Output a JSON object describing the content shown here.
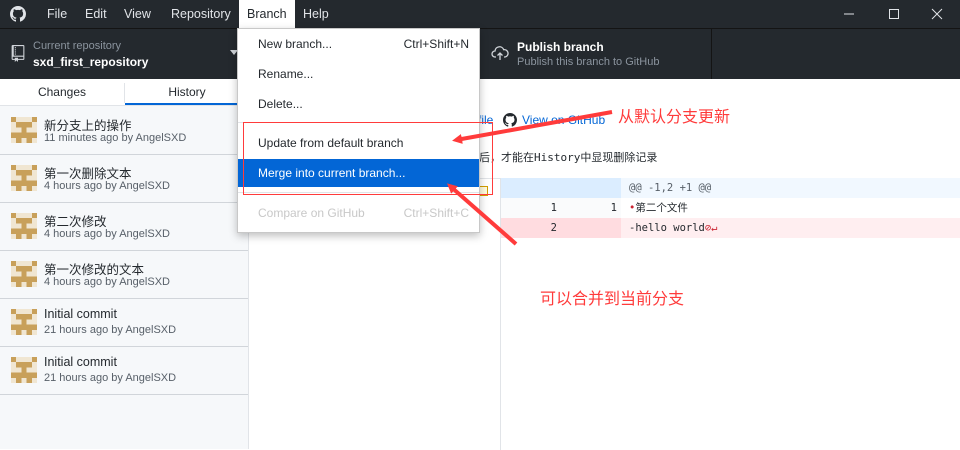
{
  "titlebar": {
    "menus": [
      "File",
      "Edit",
      "View",
      "Repository",
      "Branch",
      "Help"
    ],
    "active_menu": "Branch",
    "window_controls": [
      "minimize-icon",
      "maximize-icon",
      "close-icon"
    ]
  },
  "toolbar": {
    "repo_caption": "Current repository",
    "repo_name": "sxd_first_repository",
    "publish_title": "Publish branch",
    "publish_subtitle": "Publish this branch to GitHub"
  },
  "sidebar": {
    "tabs": [
      "Changes",
      "History"
    ],
    "selected_tab": "History",
    "commits": [
      {
        "message": "新分支上的操作",
        "meta": "11 minutes ago by AngelSXD"
      },
      {
        "message": "第一次删除文本",
        "meta": "4 hours ago by AngelSXD"
      },
      {
        "message": "第二次修改",
        "meta": "4 hours ago by AngelSXD"
      },
      {
        "message": "第一次修改的文本",
        "meta": "4 hours ago by AngelSXD"
      },
      {
        "message": "Initial commit",
        "meta": "21 hours ago by AngelSXD"
      },
      {
        "message": "Initial commit",
        "meta": "21 hours ago by AngelSXD"
      }
    ]
  },
  "detail": {
    "file_partial": "file",
    "view_on_github": "View on GitHub",
    "description": "后，才能在History中显现删除记录"
  },
  "diff": {
    "hunk": "@@ -1,2 +1 @@",
    "lines": [
      {
        "old": "1",
        "new": "1",
        "text": "第二个文件",
        "marker": "•"
      },
      {
        "old": "2",
        "new": "",
        "text": "-hello world",
        "marker": "⊘↵"
      }
    ]
  },
  "branch_menu": {
    "new_branch": "New branch...",
    "new_branch_shortcut": "Ctrl+Shift+N",
    "rename": "Rename...",
    "delete": "Delete...",
    "update_default": "Update from default branch",
    "merge_current": "Merge into current branch...",
    "compare_github": "Compare on GitHub",
    "compare_shortcut": "Ctrl+Shift+C"
  },
  "annotations": {
    "update_note": "从默认分支更新",
    "merge_note": "可以合并到当前分支",
    "color": "#ff3b3b"
  },
  "colors": {
    "accent": "#0366d6",
    "titlebar": "#24292e"
  }
}
